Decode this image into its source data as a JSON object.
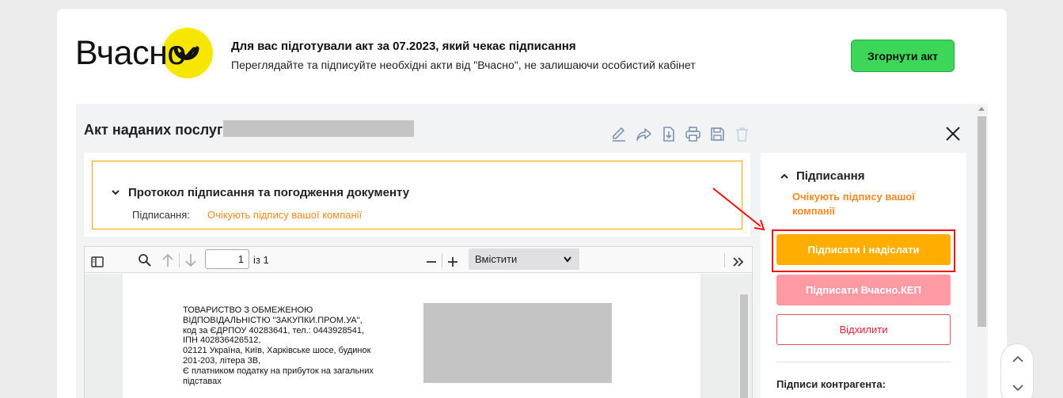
{
  "banner": {
    "logo_text": "Вчасно",
    "title": "Для вас підготували акт за 07.2023, який чекає підписання",
    "subtitle": "Переглядайте та підписуйте необхідні акти від \"Вчасно\", не залишаючи особистий кабінет",
    "collapse_label": "Згорнути акт"
  },
  "document": {
    "title": "Акт наданих послуг:",
    "toolbar_icons": [
      "edit-icon",
      "share-icon",
      "download-icon",
      "print-icon",
      "save-icon",
      "trash-icon"
    ]
  },
  "protocol": {
    "heading": "Протокол підписання та погодження документу",
    "label": "Підписання:",
    "value": "Очікують підпису вашої компанії"
  },
  "pdf_viewer": {
    "page_current": "1",
    "page_of": "із 1",
    "zoom_option": "Вмістити",
    "company_lines": [
      "ТОВАРИСТВО З ОБМЕЖЕНОЮ",
      "ВІДПОВІДАЛЬНІСТЮ \"ЗАКУПКИ.ПРОМ.УА\",",
      "код за ЄДРПОУ 40283641, тел.: 0443928541,",
      "ІПН 402836426512,",
      "02121 Україна, Київ, Харківське шосе, будинок",
      "201-203, літера 3В,",
      "Є платником податку на прибуток на загальних",
      "підставах"
    ]
  },
  "signing_panel": {
    "heading": "Підписання",
    "status": "Очікують підпису вашої компанії",
    "sign_send_label": "Підписати і надіслати",
    "sign_kep_label": "Підписати Вчасно.КЕП",
    "reject_label": "Відхилити",
    "counterparty_label": "Підписи контрагента:"
  },
  "colors": {
    "brand_yellow": "#f7e600",
    "collapse_green": "#3ed658",
    "sign_orange": "#ffad00",
    "kep_pink": "#fe9aa4",
    "status_orange": "#f08a24",
    "highlight_red": "#e11111"
  }
}
